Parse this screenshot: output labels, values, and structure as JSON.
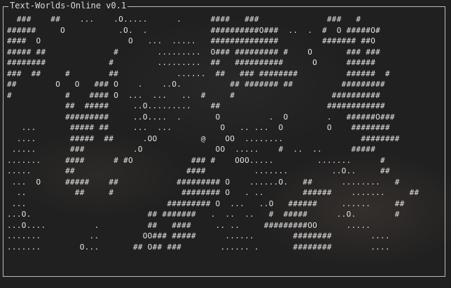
{
  "window": {
    "title": "Text-Worlds-Online v0.1"
  },
  "map": {
    "rows": [
      "  ###    ##    ...    .O.....      .      ####   ###              ###   #",
      "######     O           .O.  .             ##########O###  ..  .  #  O #####O#",
      "####  O                  O   ...  .....   ##############         ####### ##O",
      "##### ##              #        .........  O### ######### #    O       ### ###",
      "########             #         .........  ##   ##########      O      ######",
      "###  ##     #        ##            ......  ##   ### ########          ######  #",
      "##        O   O   ### O    .    ..O.          ## ####### ##          #########",
      "#           #    #### O  ...  ...   ..  #     #                    ##########",
      "            ##  #####     ..O.........    ##                      ############",
      "            #########     ..O....  .       O          .  O        .   ######O###",
      "   ...       ##### ##     ...  ...          O   .. ...  O         O    ########",
      "  ....       #####  ##      .OO         @    OO  ........                ########",
      " .....       ###          .O               OO  .....    #  ..  ..      #####",
      ".......     ####      # #O            ### #    OOO.....         .......      #",
      ".....       ##                       ####          .......         ..O..     ##",
      " ...  O     #####    ##            ######### O    ......O.   ##      ........   #",
      "  ..          ##     #              ######## O   . ..        ######    .......     ##",
      " ...                             ######### O  ...   ..O   ######     ......     ##",
      "...O.                        ## #######   .  ..  ..   #  #####      ..O.        #",
      "...O....          .          ##   ####     .. ..     #########OO      .....",
      ".......          ..         OO### #####      ......        ########        ....",
      ".......        O...       ## O## ###        ...... .       ########        ...."
    ]
  }
}
